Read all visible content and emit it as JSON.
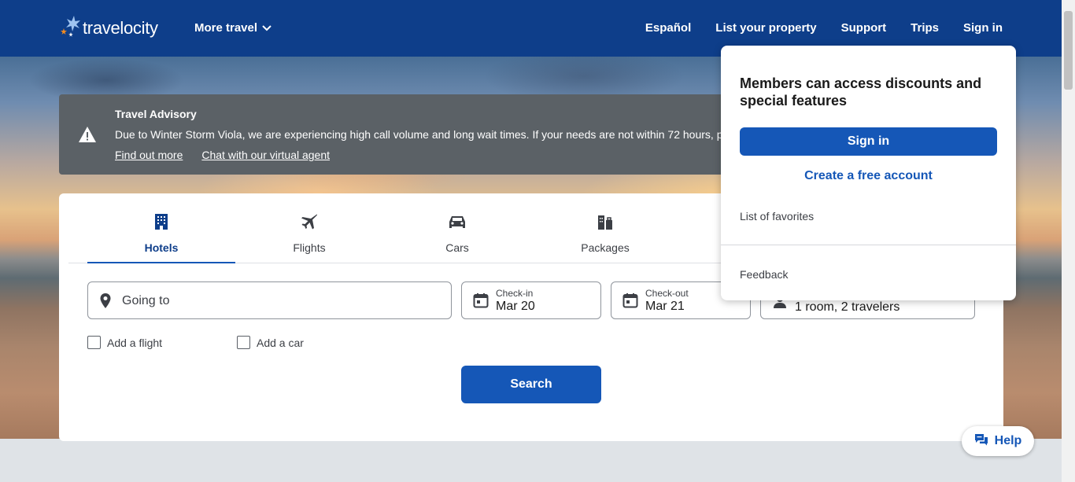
{
  "header": {
    "brand": "travelocity",
    "more_travel": "More travel",
    "nav": [
      "Español",
      "List your property",
      "Support",
      "Trips",
      "Sign in"
    ]
  },
  "advisory": {
    "title": "Travel Advisory",
    "text": "Due to Winter Storm Viola, we are experiencing high call volume and long wait times. If your needs are not within 72 hours, p",
    "links": [
      "Find out more",
      "Chat with our virtual agent"
    ]
  },
  "tabs": [
    {
      "label": "Hotels",
      "icon": "hotel-icon",
      "active": true
    },
    {
      "label": "Flights",
      "icon": "plane-icon",
      "active": false
    },
    {
      "label": "Cars",
      "icon": "car-icon",
      "active": false
    },
    {
      "label": "Packages",
      "icon": "packages-icon",
      "active": false
    }
  ],
  "search": {
    "going_to_placeholder": "Going to",
    "checkin_label": "Check-in",
    "checkin_value": "Mar 20",
    "checkout_label": "Check-out",
    "checkout_value": "Mar 21",
    "travelers_value": "1 room, 2 travelers",
    "add_flight": "Add a flight",
    "add_car": "Add a car",
    "search_button": "Search"
  },
  "account_menu": {
    "heading": "Members can access discounts and special features",
    "sign_in": "Sign in",
    "create_account": "Create a free account",
    "favorites": "List of favorites",
    "feedback": "Feedback"
  },
  "help": {
    "label": "Help"
  },
  "colors": {
    "header_bg": "#0e3e8a",
    "primary_button": "#1557b7",
    "advisory_bg": "#5b6166",
    "logo_orange": "#f28b20"
  }
}
